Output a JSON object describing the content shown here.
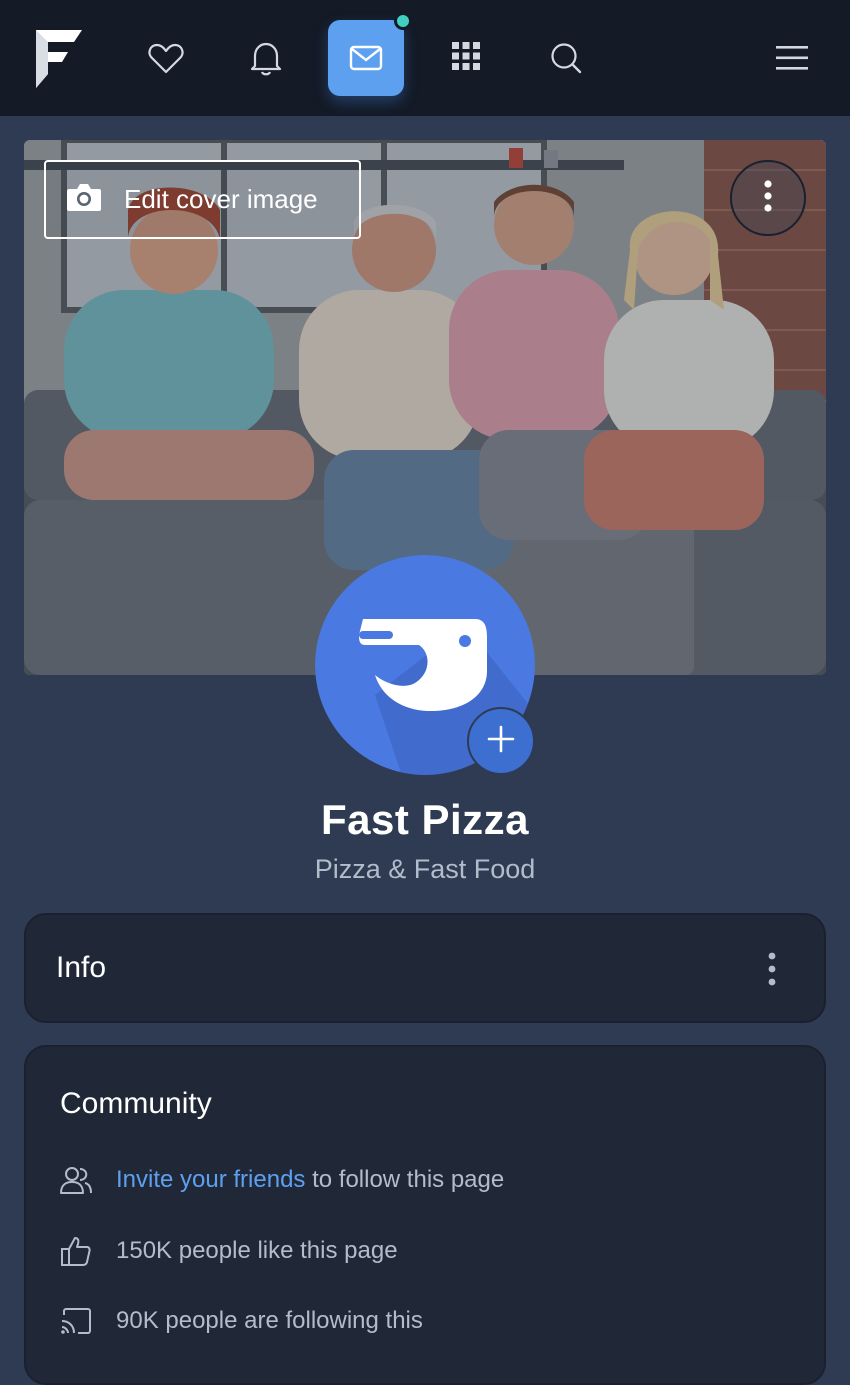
{
  "nav": {
    "logo_icon": "brand-f-logo",
    "items": [
      "heart-icon",
      "bell-icon",
      "mail-icon",
      "apps-grid-icon",
      "search-icon",
      "hamburger-menu-icon"
    ],
    "active": "mail-icon",
    "accent": "#5ea0f0",
    "notification_dot_color": "#3fd0c0"
  },
  "cover": {
    "edit_label": "Edit cover image",
    "edit_icon": "camera-icon",
    "more_icon": "vertical-dots-icon"
  },
  "profile": {
    "name": "Fast Pizza",
    "category": "Pizza & Fast Food",
    "avatar_color": "#4a79e2",
    "add_icon": "plus-icon"
  },
  "info": {
    "title": "Info",
    "more_icon": "vertical-dots-icon"
  },
  "community": {
    "title": "Community",
    "invite_link": "Invite your friends",
    "invite_suffix": " to follow this page",
    "likes": "150K people like this page",
    "followers": "90K people are following this"
  }
}
